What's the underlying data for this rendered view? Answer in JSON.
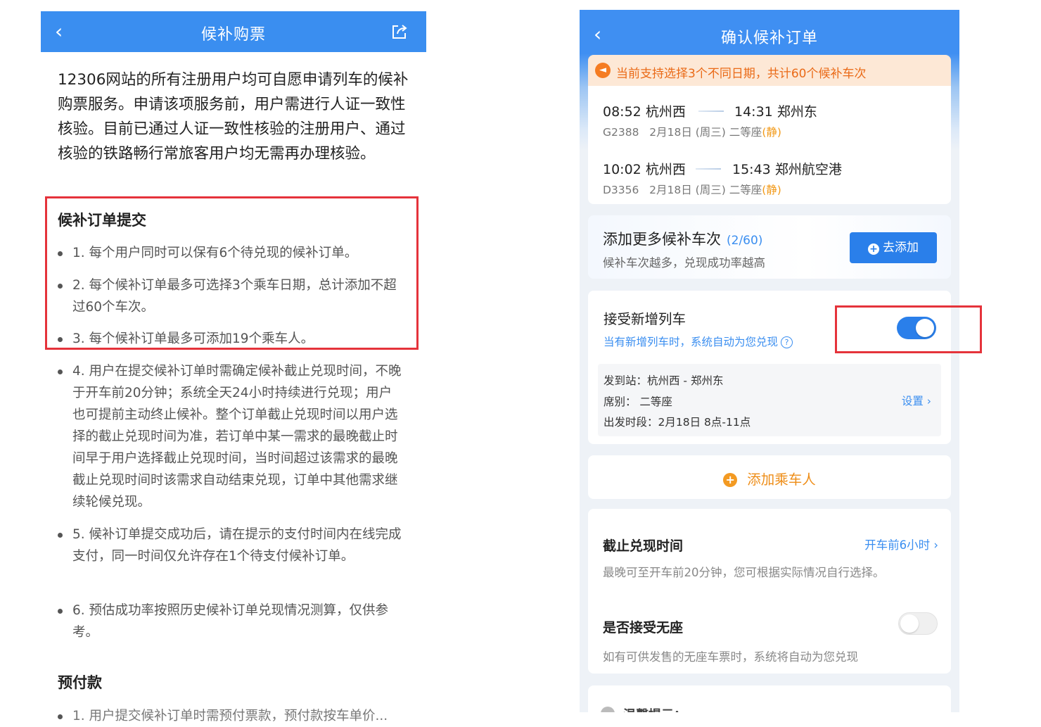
{
  "left": {
    "header": {
      "back_icon": "chevron-left-icon",
      "title": "候补购票",
      "share_icon": "share-icon"
    },
    "intro": "12306网站的所有注册用户均可自愿申请列车的候补购票服务。申请该项服务前，用户需进行人证一致性核验。目前已通过人证一致性核验的注册用户、通过核验的铁路畅行常旅客用户均无需再办理核验。",
    "section1": {
      "heading": "候补订单提交",
      "rules": [
        "1. 每个用户同时可以保有6个待兑现的候补订单。",
        "2. 每个候补订单最多可选择3个乘车日期，总计添加不超过60个车次。",
        "3. 每个候补订单最多可添加19个乘车人。",
        "4. 用户在提交候补订单时需确定候补截止兑现时间，不晚于开车前20分钟；系统全天24小时持续进行兑现；用户也可提前主动终止候补。整个订单截止兑现时间以用户选择的截止兑现时间为准，若订单中某一需求的最晚截止时间早于用户选择截止兑现时间，当时间超过该需求的最晚截止兑现时间时该需求自动结束兑现，订单中其他需求继续轮候兑现。",
        "5. 候补订单提交成功后，请在提示的支付时间内在线完成支付，同一时间仅允许存在1个待支付候补订单。",
        "6. 预估成功率按照历史候补订单兑现情况测算，仅供参考。"
      ]
    },
    "section2": {
      "heading": "预付款",
      "partial": "1. 用户提交候补订单时需预付票款，预付款按车单价..."
    }
  },
  "right": {
    "header": {
      "back_icon": "chevron-left-icon",
      "title": "确认候补订单"
    },
    "notice": {
      "icon": "megaphone-icon",
      "text": "当前支持选择3个不同日期，共计60个候补车次"
    },
    "trains": [
      {
        "dep_time": "08:52",
        "dep_station": "杭州西",
        "arr_time": "14:31",
        "arr_station": "郑州东",
        "number": "G2388",
        "date": "2月18日 (周三)",
        "seat": "二等座",
        "seat_tag": "(静)"
      },
      {
        "dep_time": "10:02",
        "dep_station": "杭州西",
        "arr_time": "15:43",
        "arr_station": "郑州航空港",
        "number": "D3356",
        "date": "2月18日 (周三)",
        "seat": "二等座",
        "seat_tag": "(静)"
      }
    ],
    "add_more": {
      "title": "添加更多候补车次",
      "count": "(2/60)",
      "subtitle": "候补车次越多，兑现成功率越高",
      "button": "去添加"
    },
    "accept_new": {
      "title": "接受新增列车",
      "subtitle": "当有新增列车时，系统自动为您兑现",
      "enabled": true,
      "route": "发到站：杭州西 - 郑州东",
      "seat": "席别：  二等座",
      "time_range": "出发时段：2月18日 8点-11点",
      "settings_link": "设置"
    },
    "add_passenger": "添加乘车人",
    "deadline": {
      "title": "截止兑现时间",
      "value": "开车前6小时",
      "desc": "最晚可至开车前20分钟，您可根据实际情况自行选择。",
      "no_seat_title": "是否接受无座",
      "no_seat_enabled": false,
      "no_seat_desc": "如有可供发售的无座车票时，系统将自动为您兑现"
    },
    "tips_title": "温馨提示："
  }
}
